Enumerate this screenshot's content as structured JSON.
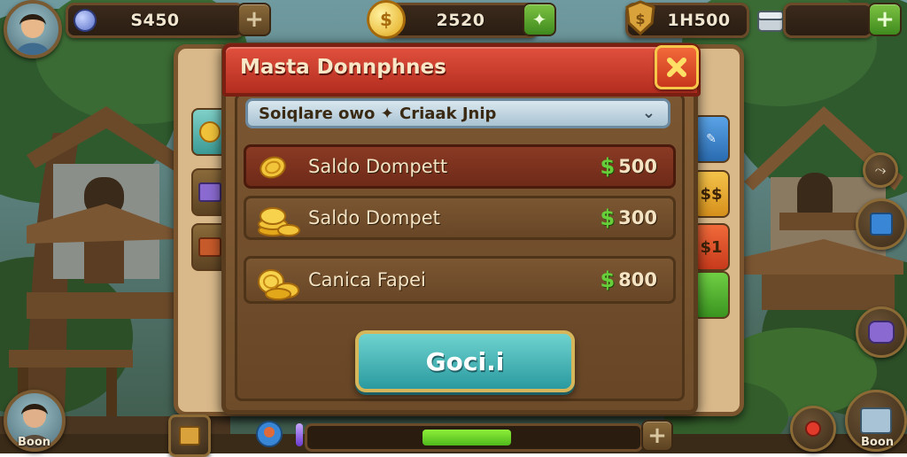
{
  "hud": {
    "gems": "S450",
    "coins": "2520",
    "tokens": "1H500"
  },
  "dialog": {
    "title": "Masta Donnphnes",
    "dropdown_text": "Soiqlare owo ✦ Criaak Jnip",
    "rows": [
      {
        "label": "Saldo Dompett",
        "amount": "500",
        "highlighted": true
      },
      {
        "label": "Saldo Dompet",
        "amount": "300",
        "highlighted": false
      },
      {
        "label": "Canica Fapei",
        "amount": "800",
        "highlighted": false
      }
    ],
    "confirm_label": "Goci.i"
  },
  "side_tabs_right": [
    "$$",
    "$1"
  ],
  "bottom": {
    "player_left_name": "Boon",
    "player_right_name": "Boon",
    "progress": 0.27
  },
  "colors": {
    "title_red": "#c93a28",
    "confirm_teal": "#3fb1b3",
    "dollar_green": "#66cf3a",
    "progress_green": "#6fd82c"
  }
}
